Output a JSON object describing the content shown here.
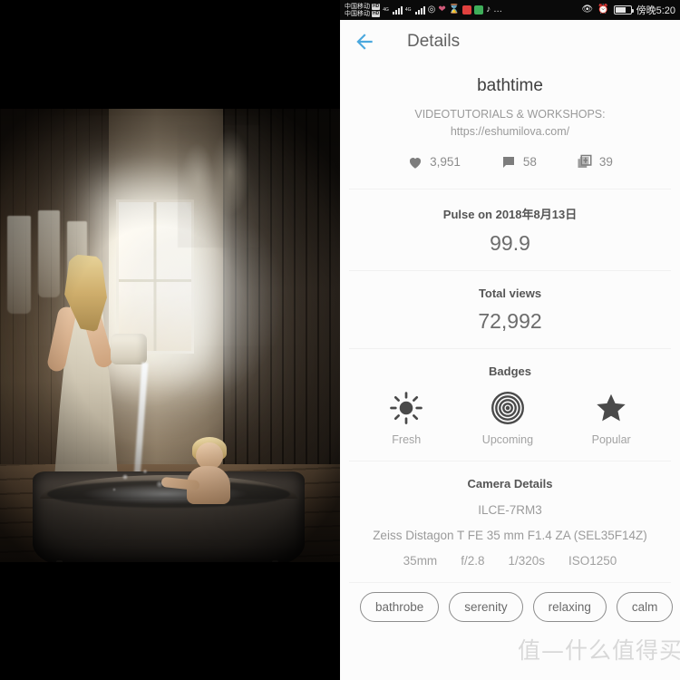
{
  "statusbar": {
    "carrier_1": "中国移动",
    "carrier_2": "中国移动",
    "hd_badge_1": "HD",
    "hd_badge_2": "HD",
    "net_1": "4G",
    "net_2": "4G",
    "hotspot_icon": "hotspot-icon",
    "heart_icon": "heart-status-icon",
    "hourglass_icon": "hourglass-icon",
    "app_icon_red": "app-icon-red",
    "app_icon_green": "app-icon-green",
    "tiktok_icon": "tiktok-icon",
    "overflow": "…",
    "eye_icon": "eye-care-icon",
    "alarm_icon": "alarm-icon",
    "battery_icon": "battery-icon",
    "time": "傍晚5:20"
  },
  "appbar": {
    "back_icon": "back-arrow-icon",
    "title": "Details",
    "accent_color": "#4ba8de"
  },
  "artwork": {
    "title": "bathtime",
    "subtitle": "VIDEOTUTORIALS & WORKSHOPS:\nhttps://eshumilova.com/",
    "stats": [
      {
        "icon": "heart-icon",
        "value": "3,951",
        "name": "likes"
      },
      {
        "icon": "comment-icon",
        "value": "58",
        "name": "comments"
      },
      {
        "icon": "add-to-gallery-icon",
        "value": "39",
        "name": "galleries"
      }
    ]
  },
  "pulse": {
    "heading": "Pulse on 2018年8月13日",
    "value": "99.9"
  },
  "views": {
    "heading": "Total views",
    "value": "72,992"
  },
  "badges": {
    "heading": "Badges",
    "items": [
      {
        "icon": "sun-icon",
        "label": "Fresh"
      },
      {
        "icon": "concentric-rings-icon",
        "label": "Upcoming"
      },
      {
        "icon": "star-icon",
        "label": "Popular"
      }
    ]
  },
  "camera": {
    "heading": "Camera Details",
    "model": "ILCE-7RM3",
    "lens": "Zeiss Distagon T FE 35 mm F1.4 ZA (SEL35F14Z)",
    "settings": [
      "35mm",
      "f/2.8",
      "1/320s",
      "ISO1250"
    ]
  },
  "tags": [
    "bathrobe",
    "serenity",
    "relaxing",
    "calm"
  ],
  "watermark": {
    "text": "值—什么值得买"
  },
  "photo": {
    "alt": "bathtime photograph: girl pouring water from a jug into a metal tub where a young child bathes, rustic wooden room with bright window"
  }
}
